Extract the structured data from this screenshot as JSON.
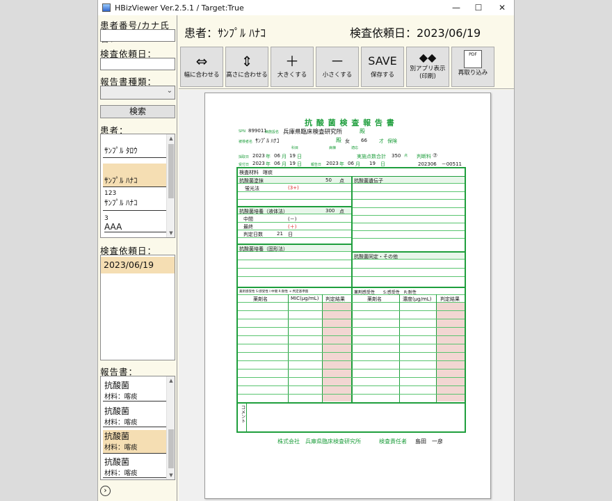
{
  "window": {
    "title": "HBizViewer Ver.2.5.1 / Target:True",
    "minimize": "—",
    "maximize": "☐",
    "close": "✕"
  },
  "left": {
    "patient_search_label": "患者番号/カナ氏名：",
    "request_date_label": "検査依頼日：",
    "report_type_label": "報告書種類：",
    "search_button": "検索",
    "patients_label": "患者：",
    "patients": [
      {
        "id": "",
        "name": "ｻﾝﾌﾟﾙ ﾀﾛｳ"
      },
      {
        "id": "",
        "name": "ｻﾝﾌﾟﾙ ﾊﾅｺ"
      },
      {
        "id": "123",
        "name": "ｻﾝﾌﾟﾙ ﾊﾅｺ"
      },
      {
        "id": "3",
        "name": "AAA"
      }
    ],
    "dates_label": "検査依頼日：",
    "dates": [
      "2023/06/19"
    ],
    "reports_label": "報告書：",
    "reports": [
      {
        "name": "抗酸菌",
        "material": "材料：喀痰"
      },
      {
        "name": "抗酸菌",
        "material": "材料：喀痰"
      },
      {
        "name": "抗酸菌",
        "material": "材料：喀痰"
      },
      {
        "name": "抗酸菌",
        "material": "材料：喀痰"
      }
    ],
    "collapse_button": "›"
  },
  "header": {
    "patient": "患者：ｻﾝﾌﾟﾙ ﾊﾅｺ",
    "request_date": "検査依頼日：2023/06/19"
  },
  "toolbar": [
    {
      "icon": "⇔",
      "label": "幅に合わせる"
    },
    {
      "icon": "⇕",
      "label": "高さに合わせる"
    },
    {
      "icon": "＋",
      "label": "大きくする"
    },
    {
      "icon": "－",
      "label": "小さくする"
    },
    {
      "icon": "SAVE",
      "label": "保存する"
    },
    {
      "icon": "◆◆",
      "label": "別アプリ表示\n(印刷)"
    },
    {
      "icon": "PDF",
      "label": "再取り込み"
    }
  ],
  "report": {
    "title": "抗 酸 菌 検 査 報 告 書",
    "spn_label": "SPN",
    "spn": "899011",
    "facility_label": "病施設名",
    "facility": "兵庫県臨床検査研究所",
    "facility_suffix": "殿",
    "patient_label": "被検者名",
    "patient_name": "ｻﾝﾌﾟﾙ ﾊﾅｺ",
    "patient_suffix": "殿",
    "sex": "女",
    "age": "66",
    "age_unit": "才",
    "insurance": "保険",
    "dept_label": "科目",
    "ward_label": "病棟",
    "doctor_label": "適応",
    "collect_label": "採取日",
    "collect_date": [
      "2023",
      "年",
      "06",
      "月",
      "19",
      "日"
    ],
    "points_label": "実施点数合計",
    "points": "350",
    "points_unit": "点",
    "fee_label": "判断料",
    "fee": "⑦",
    "receive_label": "受付日",
    "receive_date": [
      "2023",
      "年",
      "06",
      "月",
      "19",
      "日"
    ],
    "report_label": "報告日",
    "report_date": [
      "2023",
      "年",
      "06",
      "月",
      "19",
      "日"
    ],
    "report_no": "202306　－00511",
    "material_label": "検査材料",
    "material": "喀痰",
    "smear_label": "抗酸菌塗抹",
    "smear_points": "50",
    "smear_unit": "点",
    "fluor_label": "蛍光法",
    "fluor_result": "(3+)",
    "gene_label": "抗酸菌遺伝子",
    "liquid_label": "抗酸菌培養（液体法）",
    "liquid_points": "300",
    "liquid_unit": "点",
    "mid_label": "中間",
    "mid_result": "(－)",
    "final_label": "最終",
    "final_result": "(＋)",
    "days_label": "判定日数",
    "days": "21",
    "days_unit": "日",
    "solid_label": "抗酸菌培養（固形法）",
    "ident_label": "抗酸菌同定・その他",
    "sens1_label": "薬剤感受性 S:感受性 I:中間 R:耐性 +:判定基準無",
    "sens2_label": "薬剤感受性　　S:感受性　R:耐性",
    "drug_col": "薬剤名",
    "mic_col": "MIC(μg/mL)",
    "judge_col": "判定結果",
    "conc_col": "濃度(μg/mL)",
    "comment_label": "コメント",
    "footer_company": "株式会社　兵庫県臨床検査研究所",
    "footer_resp": "検査責任者",
    "footer_person": "島田　一彦"
  },
  "colors": {
    "window_bg": "#fbf9ea",
    "selected": "#f5deb3",
    "report_green": "#1e9e3c",
    "pink": "#f2d6d2"
  }
}
